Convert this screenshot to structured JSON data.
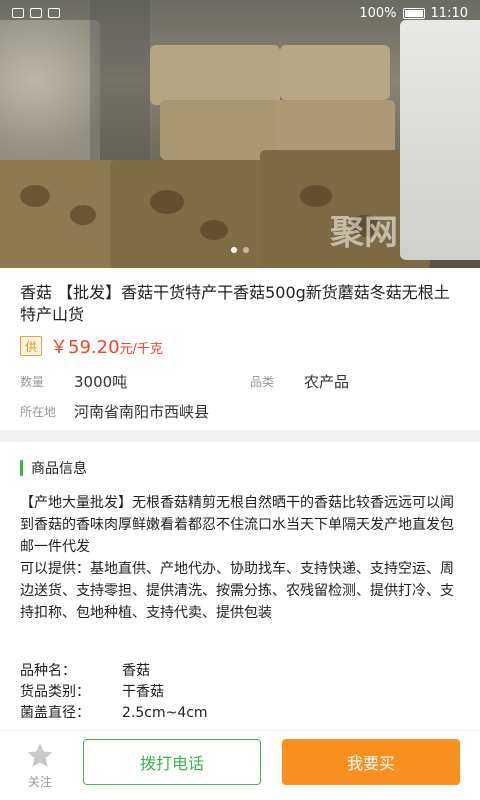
{
  "status_bar": {
    "left_time": "",
    "battery_percent": "100%",
    "time": "11:10"
  },
  "hero": {
    "image_count": 2,
    "active_index": 0,
    "watermark": "聚网"
  },
  "product": {
    "title": "香菇 【批发】香菇干货特产干香菇500g新货蘑菇冬菇无根土特产山货",
    "supply_badge": "供",
    "price": "￥59.20",
    "price_unit": "元/千克",
    "quantity_label": "数量",
    "quantity_value": "3000吨",
    "category_label": "品类",
    "category_value": "农产品",
    "location_label": "所在地",
    "location_value": "河南省南阳市西峡县"
  },
  "section": {
    "title": "商品信息"
  },
  "description": {
    "text": "【产地大量批发】无根香菇精剪无根自然晒干的香菇比较香远远可以闻到香菇的香味肉厚鲜嫩看着都忍不住流口水当天下单隔天发产地直发包邮一件代发\n可以提供：基地直供、产地代办、协助找车、支持快递、支持空运、周边送货、支持零担、提供清洗、按需分拣、农残留检测、提供打冷、支持扣称、包地种植、支持代卖、提供包装"
  },
  "specs": [
    {
      "key": "品种名：",
      "value": "香菇"
    },
    {
      "key": "货品类别：",
      "value": "干香菇"
    },
    {
      "key": "菌盖直径：",
      "value": "2.5cm~4cm"
    }
  ],
  "bottom_bar": {
    "favorite_label": "关注",
    "call_label": "拨打电话",
    "buy_label": "我要买"
  },
  "colors": {
    "accent_green": "#3db54a",
    "price_red": "#f5422a",
    "buy_orange": "#f7901e"
  }
}
